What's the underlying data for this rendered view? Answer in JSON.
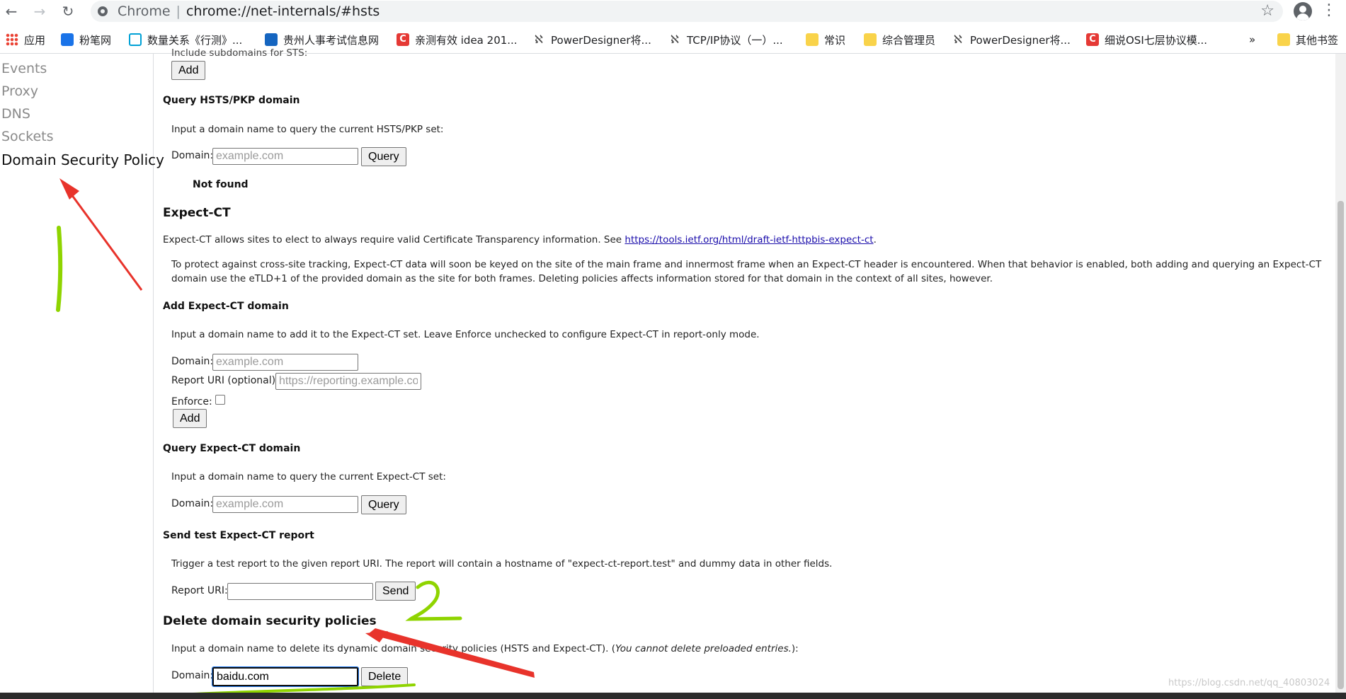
{
  "browser": {
    "site_name": "Chrome",
    "separator": "|",
    "url": "chrome://net-internals/#hsts"
  },
  "bookmarks": [
    {
      "label": "应用",
      "icon": "apps-icon"
    },
    {
      "label": "粉笔网",
      "icon": "fenbi-icon"
    },
    {
      "label": "数量关系《行测》...",
      "icon": "bilibili-icon"
    },
    {
      "label": "贵州人事考试信息网",
      "icon": "book-icon"
    },
    {
      "label": "亲测有效 idea 201...",
      "icon": "csdn-icon"
    },
    {
      "label": "PowerDesigner将...",
      "icon": "powerdesigner-icon"
    },
    {
      "label": "TCP/IP协议（一）...",
      "icon": "powerdesigner-icon"
    },
    {
      "label": "常识",
      "icon": "folder-icon"
    },
    {
      "label": "综合管理员",
      "icon": "folder-icon"
    },
    {
      "label": "PowerDesigner将...",
      "icon": "powerdesigner-icon"
    },
    {
      "label": "细说OSI七层协议模...",
      "icon": "csdn-icon"
    }
  ],
  "bookmarks_overflow": "»",
  "other_bookmarks": "其他书签",
  "sidebar": {
    "items": [
      "Events",
      "Proxy",
      "DNS",
      "Sockets",
      "Domain Security Policy"
    ]
  },
  "content": {
    "top_partial_text": "Include subdomains for STS:",
    "top_add_button": "Add",
    "query_hsts": {
      "title": "Query HSTS/PKP domain",
      "desc": "Input a domain name to query the current HSTS/PKP set:",
      "domain_label": "Domain:",
      "placeholder": "example.com",
      "button": "Query",
      "result": "Not found"
    },
    "expect_ct": {
      "title": "Expect-CT",
      "intro": "Expect-CT allows sites to elect to always require valid Certificate Transparency information. See ",
      "link": "https://tools.ietf.org/html/draft-ietf-httpbis-expect-ct",
      "intro_end": ".",
      "note": "To protect against cross-site tracking, Expect-CT data will soon be keyed on the site of the main frame and innermost frame when an Expect-CT header is encountered. When that behavior is enabled, both adding and querying an Expect-CT domain use the eTLD+1 of the provided domain as the site for both frames. Deleting policies affects information stored for that domain in the context of all sites, however."
    },
    "add_ct": {
      "title": "Add Expect-CT domain",
      "desc": "Input a domain name to add it to the Expect-CT set. Leave Enforce unchecked to configure Expect-CT in report-only mode.",
      "domain_label": "Domain:",
      "domain_placeholder": "example.com",
      "report_label": "Report URI (optional):",
      "report_placeholder": "https://reporting.example.com",
      "enforce_label": "Enforce:",
      "button": "Add"
    },
    "query_ct": {
      "title": "Query Expect-CT domain",
      "desc": "Input a domain name to query the current Expect-CT set:",
      "domain_label": "Domain:",
      "placeholder": "example.com",
      "button": "Query"
    },
    "send_report": {
      "title": "Send test Expect-CT report",
      "desc": "Trigger a test report to the given report URI. The report will contain a hostname of \"expect-ct-report.test\" and dummy data in other fields.",
      "uri_label": "Report URI:",
      "button": "Send"
    },
    "delete": {
      "title": "Delete domain security policies",
      "desc_main": "Input a domain name to delete its dynamic domain security policies (HSTS and Expect-CT). (",
      "desc_italic": "You cannot delete preloaded entries.",
      "desc_end": "):",
      "domain_label": "Domain:",
      "value": "baidu.com",
      "button": "Delete"
    }
  },
  "annotations": {
    "mark_1": "1",
    "mark_2": "2",
    "red_color": "#e8332b",
    "green_color": "#8fd400"
  },
  "watermark": "https://blog.csdn.net/qq_40803024"
}
